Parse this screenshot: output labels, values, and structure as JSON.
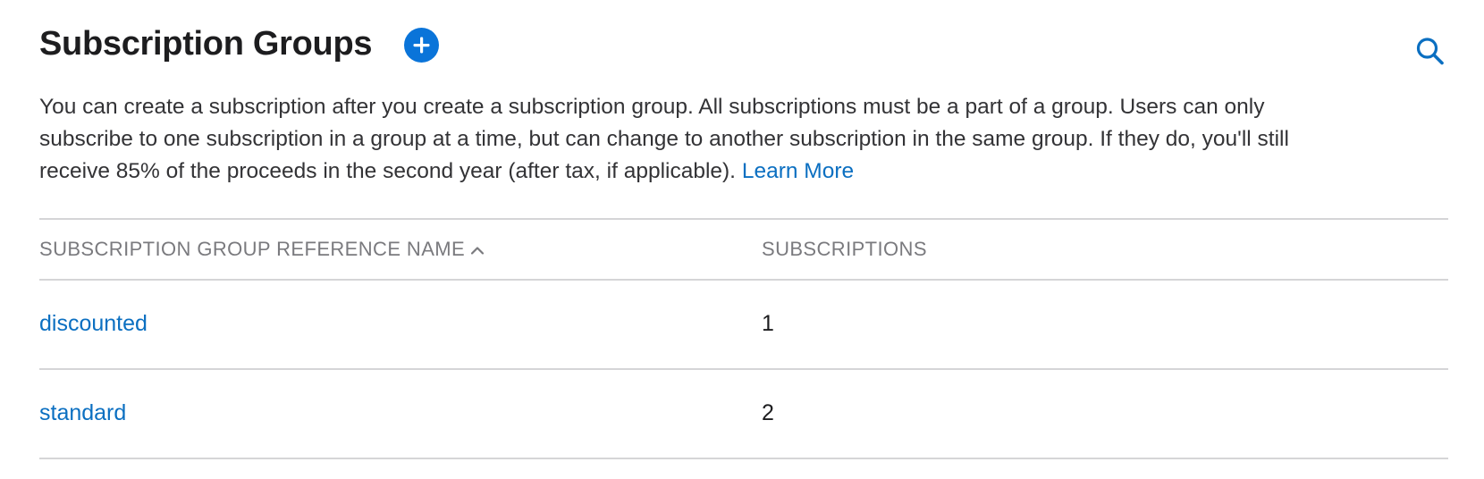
{
  "header": {
    "title": "Subscription Groups",
    "add_icon": "plus-circle-icon",
    "search_icon": "search-icon"
  },
  "description": {
    "text": "You can create a subscription after you create a subscription group. All subscriptions must be a part of a group. Users can only subscribe to one subscription in a group at a time, but can change to another subscription in the same group. If they do, you'll still receive 85% of the proceeds in the second year (after tax, if applicable).",
    "link_label": "Learn More"
  },
  "table": {
    "columns": [
      {
        "label": "SUBSCRIPTION GROUP REFERENCE NAME",
        "sort": "ascending",
        "sort_icon": "chevron-up-icon"
      },
      {
        "label": "SUBSCRIPTIONS"
      }
    ],
    "rows": [
      {
        "name": "discounted",
        "subscriptions": "1"
      },
      {
        "name": "standard",
        "subscriptions": "2"
      }
    ]
  },
  "colors": {
    "accent": "#0a74d9",
    "link": "#0b6fc1",
    "divider": "#d5d5d7",
    "header_text": "#7a7a7e"
  }
}
